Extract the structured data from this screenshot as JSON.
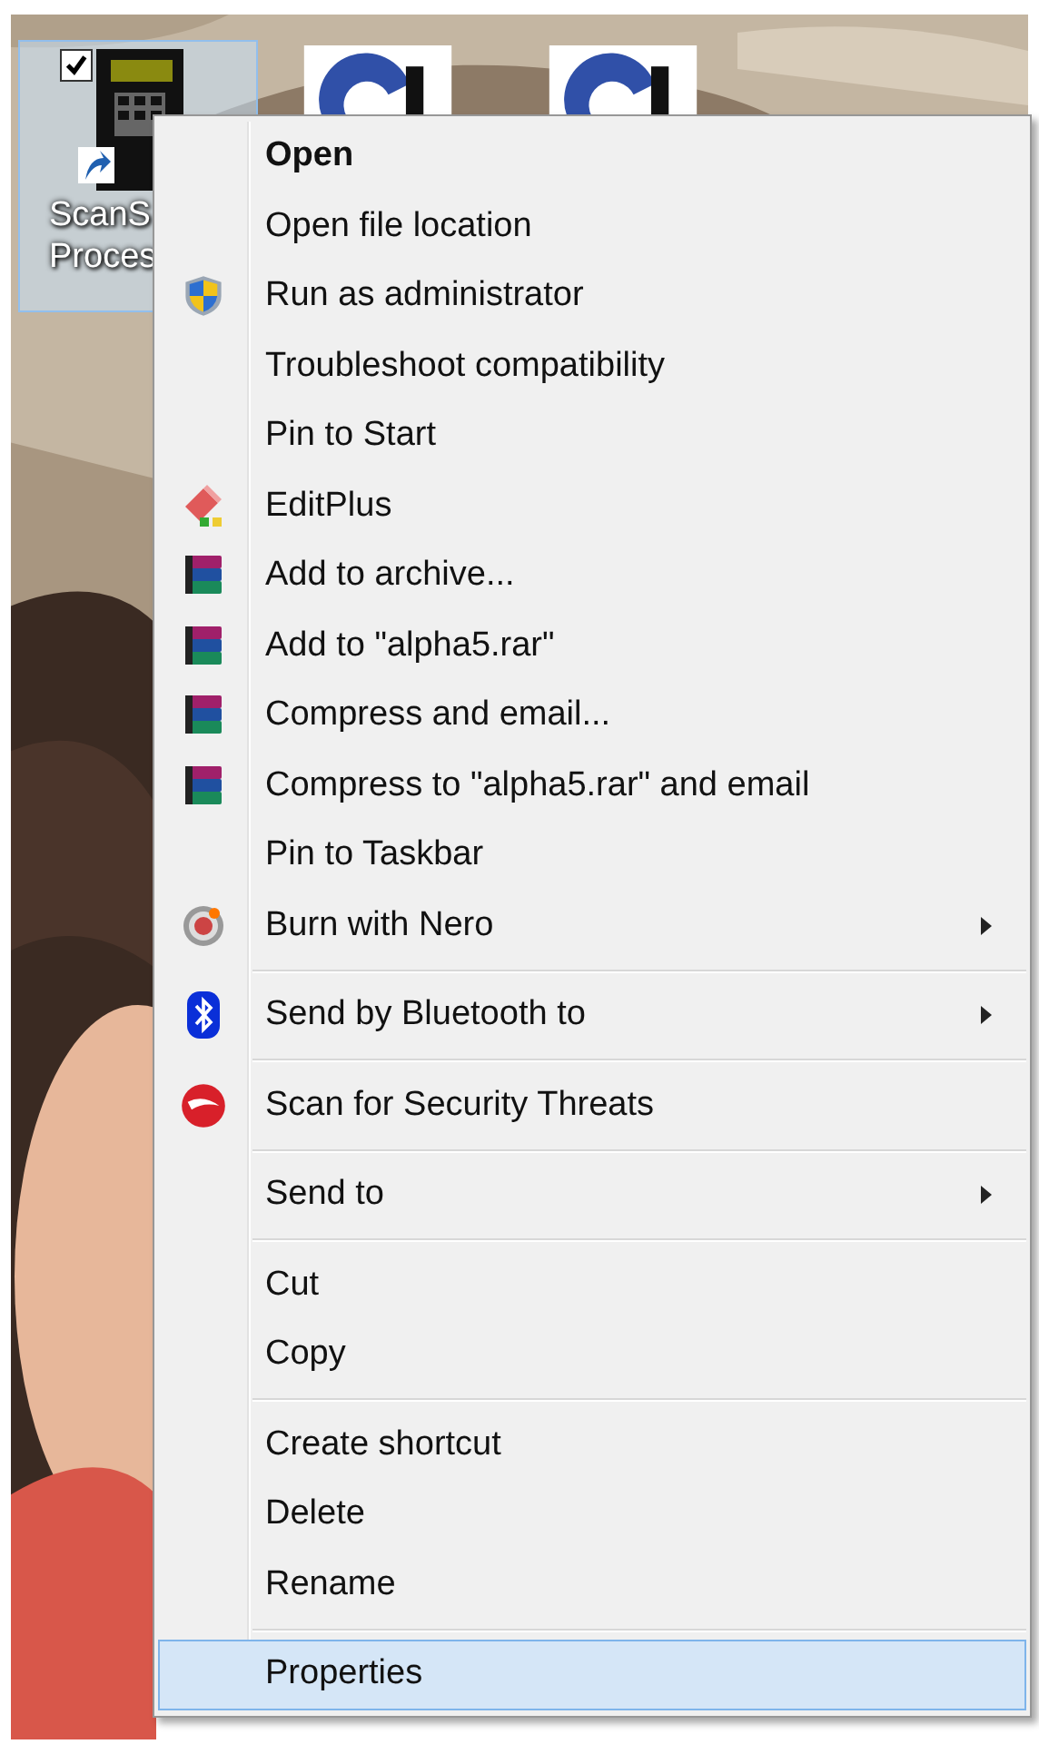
{
  "desktop_icons": [
    {
      "kind": "terminal",
      "label_lines": [
        "ScanS",
        "Proces"
      ],
      "selected": true,
      "checked": true
    },
    {
      "kind": "app"
    },
    {
      "kind": "app"
    }
  ],
  "context_menu": {
    "groups": [
      [
        {
          "label": "Open",
          "default": true,
          "submenu": false,
          "selected": false
        },
        {
          "label": "Open file location",
          "default": false,
          "submenu": false,
          "selected": false
        },
        {
          "label": "Run as administrator",
          "default": false,
          "submenu": false,
          "selected": false
        },
        {
          "label": "Troubleshoot compatibility",
          "default": false,
          "submenu": false,
          "selected": false
        },
        {
          "label": "Pin to Start",
          "default": false,
          "submenu": false,
          "selected": false
        },
        {
          "label": "EditPlus",
          "default": false,
          "submenu": false,
          "selected": false
        },
        {
          "label": "Add to archive...",
          "default": false,
          "submenu": false,
          "selected": false
        },
        {
          "label": "Add to \"alpha5.rar\"",
          "default": false,
          "submenu": false,
          "selected": false
        },
        {
          "label": "Compress and email...",
          "default": false,
          "submenu": false,
          "selected": false
        },
        {
          "label": "Compress to \"alpha5.rar\" and email",
          "default": false,
          "submenu": false,
          "selected": false
        },
        {
          "label": "Pin to Taskbar",
          "default": false,
          "submenu": false,
          "selected": false
        },
        {
          "label": "Burn with Nero",
          "default": false,
          "submenu": true,
          "selected": false
        }
      ],
      [
        {
          "label": "Send by Bluetooth to",
          "default": false,
          "submenu": true,
          "selected": false
        }
      ],
      [
        {
          "label": "Scan for Security Threats",
          "default": false,
          "submenu": false,
          "selected": false
        }
      ],
      [
        {
          "label": "Send to",
          "default": false,
          "submenu": true,
          "selected": false
        }
      ],
      [
        {
          "label": "Cut",
          "default": false,
          "submenu": false,
          "selected": false
        },
        {
          "label": "Copy",
          "default": false,
          "submenu": false,
          "selected": false
        }
      ],
      [
        {
          "label": "Create shortcut",
          "default": false,
          "submenu": false,
          "selected": false
        },
        {
          "label": "Delete",
          "default": false,
          "submenu": false,
          "selected": false
        },
        {
          "label": "Rename",
          "default": false,
          "submenu": false,
          "selected": false
        }
      ],
      [
        {
          "label": "Properties",
          "default": false,
          "submenu": false,
          "selected": true
        }
      ]
    ]
  }
}
